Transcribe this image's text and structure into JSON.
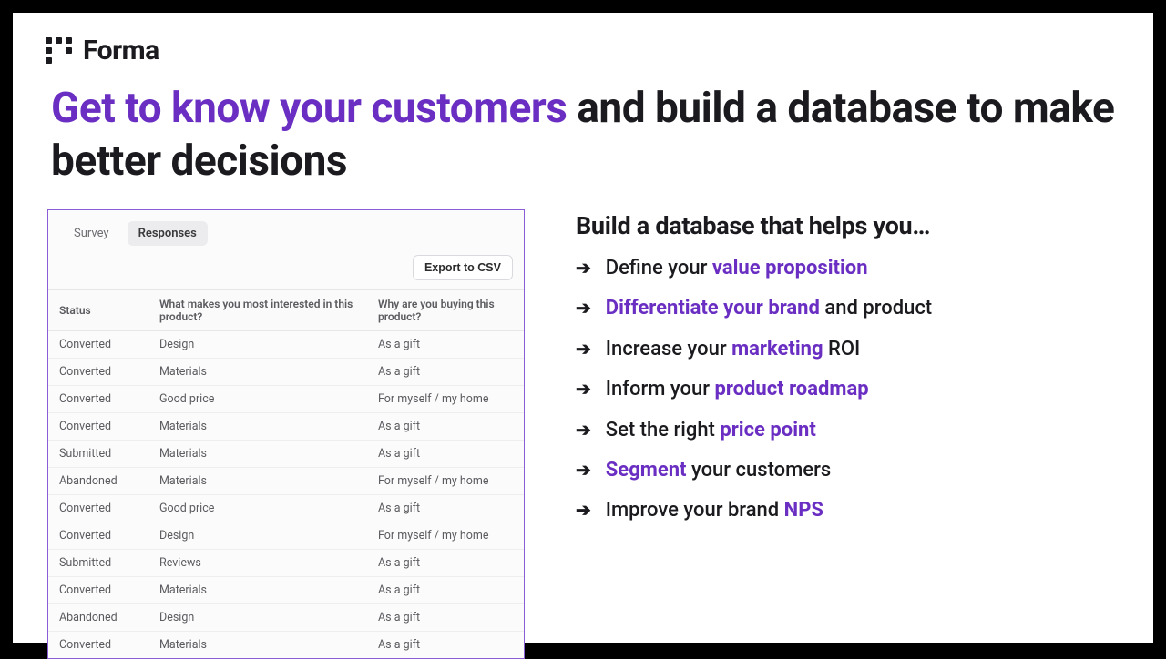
{
  "brand": {
    "name": "Forma"
  },
  "headline": {
    "accent": "Get to know your customers",
    "rest": " and build a database to make better decisions"
  },
  "panel": {
    "tabs": {
      "survey": "Survey",
      "responses": "Responses"
    },
    "export_label": "Export to CSV",
    "columns": {
      "status": "Status",
      "q1": "What makes you most interested in this product?",
      "q2": "Why are you buying this product?"
    },
    "rows": [
      {
        "status": "Converted",
        "q1": "Design",
        "q2": "As a gift"
      },
      {
        "status": "Converted",
        "q1": "Materials",
        "q2": "As a gift"
      },
      {
        "status": "Converted",
        "q1": "Good price",
        "q2": "For myself / my home"
      },
      {
        "status": "Converted",
        "q1": "Materials",
        "q2": "As a gift"
      },
      {
        "status": "Submitted",
        "q1": "Materials",
        "q2": "As a gift"
      },
      {
        "status": "Abandoned",
        "q1": "Materials",
        "q2": "For myself / my home"
      },
      {
        "status": "Converted",
        "q1": "Good price",
        "q2": "As a gift"
      },
      {
        "status": "Converted",
        "q1": "Design",
        "q2": "For myself / my home"
      },
      {
        "status": "Submitted",
        "q1": "Reviews",
        "q2": "As a gift"
      },
      {
        "status": "Converted",
        "q1": "Materials",
        "q2": "As a gift"
      },
      {
        "status": "Abandoned",
        "q1": "Design",
        "q2": "As a gift"
      },
      {
        "status": "Converted",
        "q1": "Materials",
        "q2": "As a gift"
      }
    ]
  },
  "benefits": {
    "heading": "Build a database that helps you…",
    "items": [
      {
        "pre": "Define your ",
        "b": "value proposition",
        "post": ""
      },
      {
        "pre": "",
        "b": "Differentiate your brand",
        "post": " and product"
      },
      {
        "pre": "Increase your ",
        "b": "marketing",
        "post": " ROI"
      },
      {
        "pre": "Inform your ",
        "b": "product roadmap",
        "post": ""
      },
      {
        "pre": "Set the right ",
        "b": "price point",
        "post": ""
      },
      {
        "pre": "",
        "b": "Segment",
        "post": " your customers"
      },
      {
        "pre": "Improve your brand ",
        "b": "NPS",
        "post": ""
      }
    ]
  }
}
